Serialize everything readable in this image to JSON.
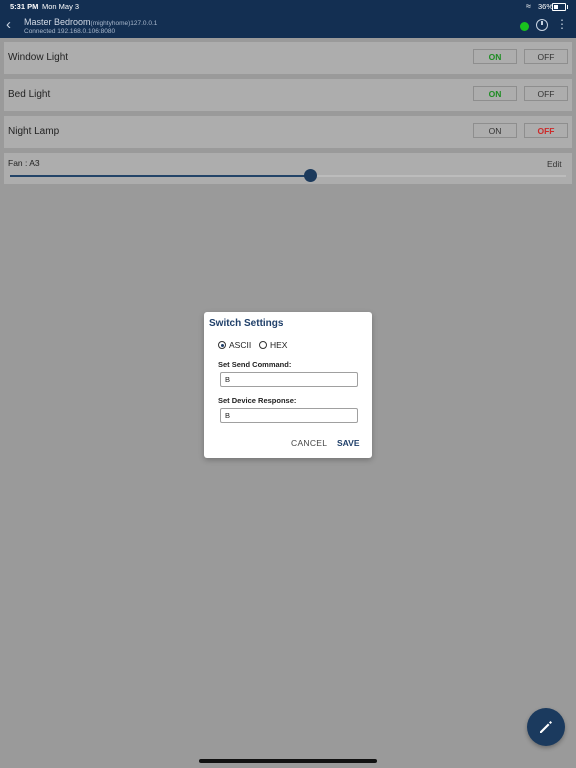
{
  "status_bar": {
    "time": "5:31 PM",
    "date": "Mon May 3",
    "battery": "36%"
  },
  "header": {
    "title": "Master Bedroom",
    "title_suffix": "(mightyhome)127.0.0.1",
    "subtitle": "Connected 192.168.0.106:8080",
    "connection_color": "#19c21e"
  },
  "switches": [
    {
      "label": "Window Light",
      "on_label": "ON",
      "off_label": "OFF",
      "state": "on"
    },
    {
      "label": "Bed Light",
      "on_label": "ON",
      "off_label": "OFF",
      "state": "on"
    },
    {
      "label": "Night Lamp",
      "on_label": "ON",
      "off_label": "OFF",
      "state": "off"
    }
  ],
  "fan": {
    "label": "Fan : A3",
    "edit_label": "Edit",
    "value_percent": 54
  },
  "dialog": {
    "title": "Switch Settings",
    "format_options": [
      "ASCII",
      "HEX"
    ],
    "selected_format": "ASCII",
    "send_command_label": "Set Send Command:",
    "send_command_value": "B",
    "device_response_label": "Set Device Response:",
    "device_response_value": "B",
    "cancel_label": "CANCEL",
    "save_label": "SAVE"
  },
  "fab": {
    "icon": "pencil-icon"
  },
  "colors": {
    "header": "#132f52",
    "accent": "#1f3f69",
    "on": "#1e8c23",
    "off": "#cc2b2b"
  }
}
